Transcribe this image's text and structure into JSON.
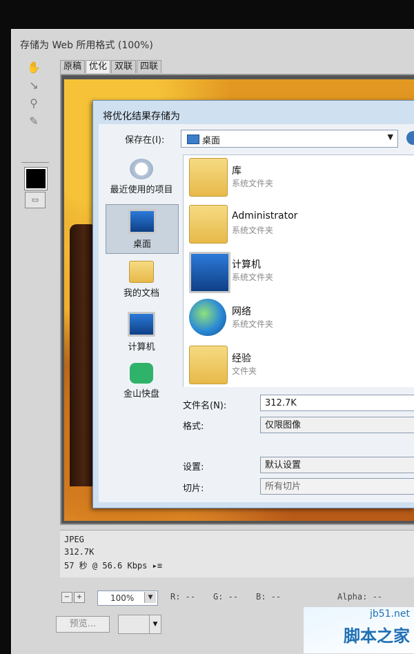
{
  "window": {
    "title": "存储为 Web 所用格式 (100%)"
  },
  "tools": [
    {
      "name": "hand-tool-icon",
      "glyph": "✋"
    },
    {
      "name": "slice-select-tool-icon",
      "glyph": "↘"
    },
    {
      "name": "zoom-tool-icon",
      "glyph": "⚲"
    },
    {
      "name": "eyedropper-tool-icon",
      "glyph": "✎"
    }
  ],
  "tabs": [
    {
      "label": "原稿",
      "active": false
    },
    {
      "label": "优化",
      "active": true
    },
    {
      "label": "双联",
      "active": false
    },
    {
      "label": "四联",
      "active": false
    }
  ],
  "save_dialog": {
    "title": "将优化结果存储为",
    "save_in_label": "保存在(I):",
    "save_in_value": "桌面",
    "places": [
      {
        "label": "最近使用的项目",
        "icon": "recent-items-icon",
        "selected": false
      },
      {
        "label": "桌面",
        "icon": "desktop-icon",
        "selected": true
      },
      {
        "label": "我的文档",
        "icon": "documents-folder-icon",
        "selected": false
      },
      {
        "label": "计算机",
        "icon": "computer-icon",
        "selected": false
      },
      {
        "label": "金山快盘",
        "icon": "kuaipan-icon",
        "selected": false
      }
    ],
    "files": [
      {
        "name": "库",
        "type": "系统文件夹",
        "icon": "library-folder-icon"
      },
      {
        "name": "Administrator",
        "type": "系统文件夹",
        "icon": "user-folder-icon"
      },
      {
        "name": "计算机",
        "type": "系统文件夹",
        "icon": "computer-icon"
      },
      {
        "name": "网络",
        "type": "系统文件夹",
        "icon": "network-icon"
      },
      {
        "name": "经验",
        "type": "文件夹",
        "icon": "folder-icon"
      }
    ],
    "filename_label": "文件名(N):",
    "filename_value": "312.7K",
    "format_label": "格式:",
    "format_value": "仅限图像",
    "settings_label": "设置:",
    "settings_value": "默认设置",
    "slices_label": "切片:",
    "slices_value": "所有切片"
  },
  "info": {
    "format": "JPEG",
    "size": "312.7K",
    "time": "57 秒 @ 56.6 Kbps"
  },
  "status": {
    "zoom": "100%",
    "r": "R: --",
    "g": "G: --",
    "b": "B: --",
    "alpha": "Alpha: --"
  },
  "buttons": {
    "preview": "预览..."
  },
  "watermark": {
    "site": "jb51.net",
    "text": "脚本之家"
  }
}
